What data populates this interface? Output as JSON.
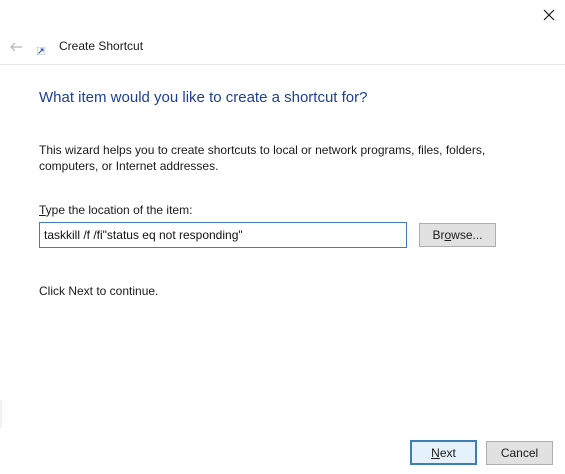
{
  "window": {
    "title": "Create Shortcut"
  },
  "wizard": {
    "heading": "What item would you like to create a shortcut for?",
    "description": "This wizard helps you to create shortcuts to local or network programs, files, folders, computers, or Internet addresses.",
    "location_label_mnemonic": "T",
    "location_label_rest": "ype the location of the item:",
    "location_value": "taskkill /f /fi\"status eq not responding\"",
    "browse_label_mnemonic": "Br",
    "browse_label_u": "o",
    "browse_label_rest": "wse...",
    "continue_text": "Click Next to continue."
  },
  "footer": {
    "next_mnemonic": "N",
    "next_rest": "ext",
    "cancel_label": "Cancel"
  },
  "icons": {
    "close": "close-icon",
    "back": "back-arrow-icon",
    "app": "shortcut-icon"
  },
  "colors": {
    "heading": "#1f3f95",
    "focus_border": "#3c7fb1",
    "button_bg": "#e1e1e1",
    "default_button_bg": "#e5f1fb"
  }
}
